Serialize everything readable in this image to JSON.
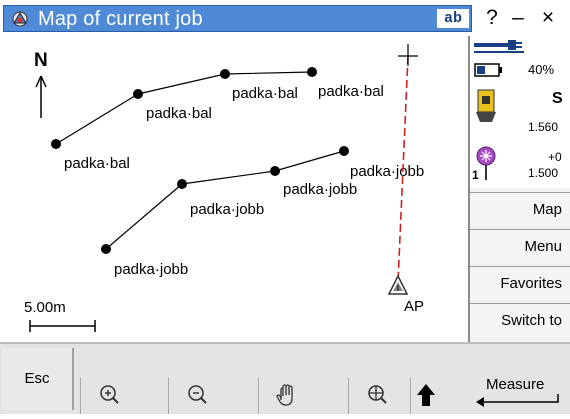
{
  "window": {
    "title": "Map of current job",
    "ab_label": "ab",
    "help_label": "?",
    "minimize_label": "–",
    "close_label": "×"
  },
  "map": {
    "north_label": "N",
    "scale_label": "5.00m",
    "lines": [
      {
        "label": "padka·bal",
        "points": [
          "padka·bal",
          "padka·bal",
          "padka·bal",
          "padka·bal"
        ]
      },
      {
        "label": "padka·jobb",
        "points": [
          "padka·jobb",
          "padka·jobb",
          "padka·jobb",
          "padka·jobb"
        ]
      }
    ],
    "point_labels": [
      "padka·bal",
      "padka·bal",
      "padka·bal",
      "padka·bal",
      "padka·jobb",
      "padka·jobb",
      "padka·jobb",
      "padka·jobb"
    ],
    "station_label": "AP"
  },
  "status": {
    "battery": "40%",
    "instrument_code": "S",
    "instrument_height": "1.560",
    "target_offset": "+0",
    "target_height": "1.500",
    "target_number": "1"
  },
  "sidebar": {
    "buttons": [
      "Map",
      "Menu",
      "Favorites",
      "Switch to"
    ]
  },
  "bottom": {
    "esc": "Esc",
    "measure": "Measure"
  },
  "colors": {
    "title_bar": "#4f8ad6",
    "accent_dark": "#1a3f86",
    "stake_line": "#cc2222",
    "target_purple": "#a64ac9"
  }
}
